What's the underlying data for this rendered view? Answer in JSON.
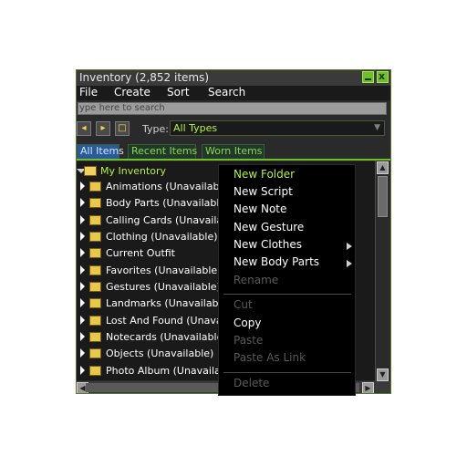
{
  "window": {
    "title": "Inventory (2,852 items)",
    "minimize_label": "_",
    "close_label": "x"
  },
  "menubar": {
    "items": [
      "File",
      "Create",
      "Sort",
      "Search"
    ]
  },
  "search": {
    "placeholder": "ype here to search"
  },
  "toolbar": {
    "type_label": "Type:",
    "type_value": "All Types"
  },
  "tabs": [
    {
      "label": "All Items",
      "active": true
    },
    {
      "label": "Recent Items",
      "active": false
    },
    {
      "label": "Worn Items",
      "active": false
    }
  ],
  "tree": {
    "root_label": "My Inventory",
    "items": [
      {
        "label": "Animations (Unavailable)",
        "icon": "animation-folder-icon"
      },
      {
        "label": "Body Parts (Unavailable)",
        "icon": "bodypart-folder-icon"
      },
      {
        "label": "Calling Cards (Unavailable",
        "icon": "callingcard-folder-icon"
      },
      {
        "label": "Clothing (Unavailable)",
        "icon": "clothing-folder-icon"
      },
      {
        "label": "Current Outfit",
        "icon": "outfit-folder-icon"
      },
      {
        "label": "Favorites (Unavailable)",
        "icon": "favorites-folder-icon"
      },
      {
        "label": "Gestures (Unavailable)",
        "icon": "gesture-folder-icon"
      },
      {
        "label": "Landmarks (Unavailable)",
        "icon": "landmark-folder-icon"
      },
      {
        "label": "Lost And Found (Unavaila",
        "icon": "lostfound-folder-icon"
      },
      {
        "label": "Notecards (Unavailable)",
        "icon": "notecard-folder-icon"
      },
      {
        "label": "Objects (Unavailable)",
        "icon": "object-folder-icon"
      },
      {
        "label": "Photo Album (Unavailabl",
        "icon": "photo-folder-icon"
      }
    ]
  },
  "context_menu": {
    "items": [
      {
        "label": "New Folder",
        "state": "highlighted"
      },
      {
        "label": "New Script",
        "state": "enabled"
      },
      {
        "label": "New Note",
        "state": "enabled"
      },
      {
        "label": "New Gesture",
        "state": "enabled"
      },
      {
        "label": "New Clothes",
        "state": "enabled",
        "submenu": true
      },
      {
        "label": "New Body Parts",
        "state": "enabled",
        "submenu": true
      },
      {
        "label": "Rename",
        "state": "disabled"
      },
      {
        "label": "Cut",
        "state": "disabled"
      },
      {
        "label": "Copy",
        "state": "enabled"
      },
      {
        "label": "Paste",
        "state": "disabled"
      },
      {
        "label": "Paste As Link",
        "state": "disabled"
      },
      {
        "label": "Delete",
        "state": "disabled"
      }
    ]
  },
  "colors": {
    "accent": "#b6f23a",
    "window_bg": "#2a2a2a",
    "menu_bg": "#000000"
  }
}
